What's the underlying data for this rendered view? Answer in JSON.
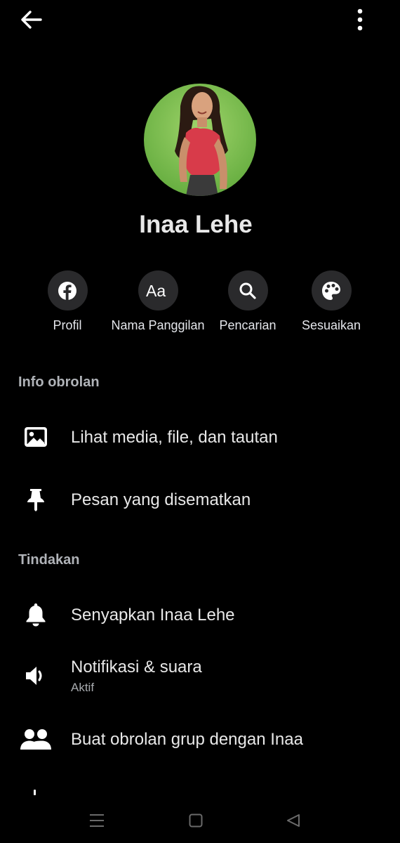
{
  "contact": {
    "name": "Inaa Lehe"
  },
  "topbar": {
    "back_icon": "arrow-left-icon",
    "menu_icon": "more-vertical-icon"
  },
  "actions": [
    {
      "label": "Profil",
      "icon": "facebook-icon"
    },
    {
      "label": "Nama Panggilan",
      "icon": "text-aa-icon"
    },
    {
      "label": "Pencarian",
      "icon": "search-icon"
    },
    {
      "label": "Sesuaikan",
      "icon": "palette-icon"
    }
  ],
  "sections": {
    "info": {
      "title": "Info obrolan",
      "items": [
        {
          "label": "Lihat media, file, dan tautan",
          "icon": "image-icon"
        },
        {
          "label": "Pesan yang disematkan",
          "icon": "pin-icon"
        }
      ]
    },
    "actions": {
      "title": "Tindakan",
      "items": [
        {
          "label": "Senyapkan Inaa Lehe",
          "icon": "bell-icon"
        },
        {
          "label": "Notifikasi & suara",
          "sublabel": "Aktif",
          "icon": "speaker-icon"
        },
        {
          "label": "Buat obrolan grup dengan Inaa",
          "icon": "group-icon"
        }
      ]
    }
  },
  "navbar": {
    "icons": [
      "menu-icon",
      "home-square-icon",
      "back-triangle-icon"
    ]
  },
  "colors": {
    "background": "#000000",
    "text": "#e8e8e8",
    "section_title": "#b0b3b8",
    "action_circle": "#2a2a2c"
  }
}
